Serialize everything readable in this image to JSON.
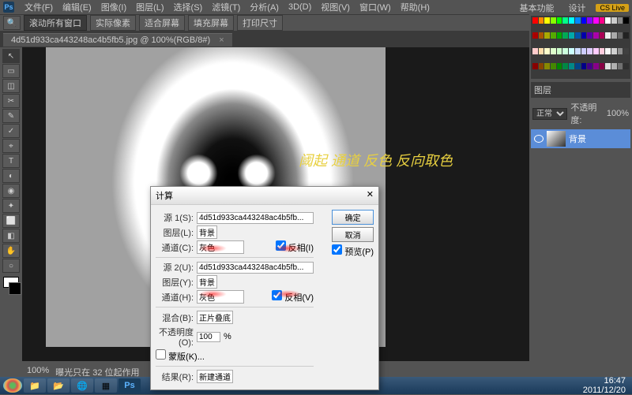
{
  "menu": {
    "items": [
      "文件(F)",
      "编辑(E)",
      "图像(I)",
      "图层(L)",
      "选择(S)",
      "滤镜(T)",
      "分析(A)",
      "3D(D)",
      "视图(V)",
      "窗口(W)",
      "帮助(H)"
    ]
  },
  "topright": {
    "basic": "基本功能",
    "cslive": "CS Live",
    "design": "设计"
  },
  "optbar": {
    "select": "滚动所有窗口",
    "b1": "实际像素",
    "b2": "适合屏幕",
    "b3": "填充屏幕",
    "b4": "打印尺寸"
  },
  "tab": {
    "name": "4d51d933ca443248ac4b5fb5.jpg @ 100%(RGB/8#)",
    "close": "×"
  },
  "overlay": "阈起 通道 反色 反向取色",
  "dialog": {
    "title": "计算",
    "s1_lbl": "源 1(S):",
    "s1_val": "4d51d933ca443248ac4b5fb...",
    "layer1_lbl": "图层(L):",
    "layer1_val": "背景",
    "chan1_lbl": "通道(C):",
    "chan1_val": "灰色",
    "inv1": "反相(I)",
    "s2_lbl": "源 2(U):",
    "s2_val": "4d51d933ca443248ac4b5fb...",
    "layer2_lbl": "图层(Y):",
    "layer2_val": "背景",
    "chan2_lbl": "通道(H):",
    "chan2_val": "灰色",
    "inv2": "反相(V)",
    "blend_lbl": "混合(B):",
    "blend_val": "正片叠底",
    "opacity_lbl": "不透明度(O):",
    "opacity_val": "100",
    "pct": "%",
    "mask": "蒙版(K)...",
    "result_lbl": "结果(R):",
    "result_val": "新建通道",
    "ok": "确定",
    "cancel": "取消",
    "preview": "预览(P)"
  },
  "layers": {
    "tab": "图层",
    "mode": "正常",
    "opacity_lbl": "不透明度:",
    "opacity": "100%",
    "row": "背景"
  },
  "status": {
    "zoom": "100%",
    "info": "曝光只在 32 位起作用"
  },
  "taskbar": {
    "time": "16:47",
    "date": "2011/12/20"
  },
  "tools": [
    "↖",
    "▭",
    "◫",
    "✂",
    "✎",
    "✓",
    "⌖",
    "T",
    "◐",
    "◉",
    "✦",
    "⬜",
    "◧",
    "✋",
    "○"
  ],
  "swatch_colors": [
    "#ff0000",
    "#ff8800",
    "#ffff00",
    "#88ff00",
    "#00ff00",
    "#00ff88",
    "#00ffff",
    "#0088ff",
    "#0000ff",
    "#8800ff",
    "#ff00ff",
    "#ff0088",
    "#ffffff",
    "#cccccc",
    "#888888",
    "#000000",
    "#aa0000",
    "#aa5500",
    "#aaaa00",
    "#55aa00",
    "#00aa00",
    "#00aa55",
    "#00aaaa",
    "#0055aa",
    "#0000aa",
    "#5500aa",
    "#aa00aa",
    "#aa0055",
    "#eeeeee",
    "#aaaaaa",
    "#666666",
    "#222222",
    "#ffcccc",
    "#ffddaa",
    "#ffffcc",
    "#ddffcc",
    "#ccffcc",
    "#ccffdd",
    "#ccffff",
    "#ccddff",
    "#ccccff",
    "#ddccff",
    "#ffccff",
    "#ffccdd",
    "#f8f8f8",
    "#d0d0d0",
    "#909090",
    "#404040",
    "#880000",
    "#884400",
    "#888800",
    "#448800",
    "#008800",
    "#008844",
    "#008888",
    "#004488",
    "#000088",
    "#440088",
    "#880088",
    "#880044",
    "#e0e0e0",
    "#b0b0b0",
    "#707070",
    "#303030"
  ]
}
